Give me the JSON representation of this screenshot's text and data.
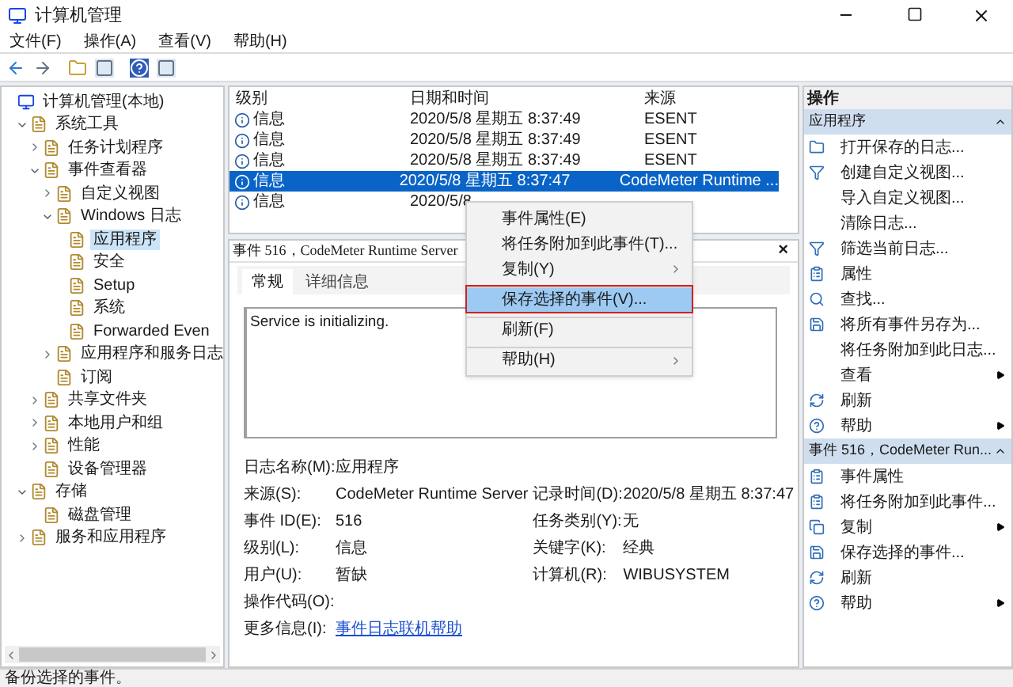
{
  "window": {
    "title": "计算机管理"
  },
  "menu": [
    "文件(F)",
    "操作(A)",
    "查看(V)",
    "帮助(H)"
  ],
  "tree": [
    {
      "label": "计算机管理(本地)",
      "selected": false,
      "children": [
        {
          "label": "系统工具",
          "expanded": true,
          "selected": false,
          "children": [
            {
              "label": "任务计划程序",
              "expanded": false,
              "selected": false
            },
            {
              "label": "事件查看器",
              "expanded": true,
              "selected": false,
              "children": [
                {
                  "label": "自定义视图",
                  "expanded": false,
                  "selected": false
                },
                {
                  "label": "Windows 日志",
                  "expanded": true,
                  "selected": false,
                  "children": [
                    {
                      "label": "应用程序",
                      "selected": true
                    },
                    {
                      "label": "安全",
                      "selected": false
                    },
                    {
                      "label": "Setup",
                      "selected": false
                    },
                    {
                      "label": "系统",
                      "selected": false
                    },
                    {
                      "label": "Forwarded Even",
                      "selected": false
                    }
                  ]
                },
                {
                  "label": "应用程序和服务日志",
                  "expanded": false,
                  "selected": false
                },
                {
                  "label": "订阅",
                  "selected": false
                }
              ]
            },
            {
              "label": "共享文件夹",
              "expanded": false,
              "selected": false
            },
            {
              "label": "本地用户和组",
              "expanded": false,
              "selected": false
            },
            {
              "label": "性能",
              "expanded": false,
              "selected": false
            },
            {
              "label": "设备管理器",
              "selected": false
            }
          ]
        },
        {
          "label": "存储",
          "expanded": true,
          "selected": false,
          "children": [
            {
              "label": "磁盘管理",
              "selected": false
            }
          ]
        },
        {
          "label": "服务和应用程序",
          "expanded": false,
          "selected": false
        }
      ]
    }
  ],
  "events": {
    "columns": [
      "级别",
      "日期和时间",
      "来源"
    ],
    "rows": [
      {
        "cells": [
          "信息",
          "2020/5/8 星期五 8:37:49",
          "ESENT"
        ],
        "selected": false
      },
      {
        "cells": [
          "信息",
          "2020/5/8 星期五 8:37:49",
          "ESENT"
        ],
        "selected": false
      },
      {
        "cells": [
          "信息",
          "2020/5/8 星期五 8:37:49",
          "ESENT"
        ],
        "selected": false
      },
      {
        "cells": [
          "信息",
          "2020/5/8 星期五 8:37:47",
          "CodeMeter Runtime ..."
        ],
        "selected": true
      },
      {
        "cells": [
          "信息",
          "2020/5/8"
        ],
        "selected": false
      }
    ]
  },
  "context_menu": [
    {
      "label": "事件属性(E)",
      "submenu": false,
      "separator_before": false,
      "selected": false
    },
    {
      "label": "将任务附加到此事件(T)...",
      "submenu": false,
      "separator_before": false,
      "selected": false
    },
    {
      "label": "复制(Y)",
      "submenu": true,
      "separator_before": false,
      "selected": false
    },
    {
      "label": "保存选择的事件(V)...",
      "submenu": false,
      "separator_before": true,
      "selected": true
    },
    {
      "label": "刷新(F)",
      "submenu": false,
      "separator_before": true,
      "selected": false
    },
    {
      "label": "帮助(H)",
      "submenu": true,
      "separator_before": true,
      "selected": false
    }
  ],
  "detail": {
    "title": "事件 516，CodeMeter Runtime Server",
    "close": "×",
    "tabs": [
      {
        "label": "常规",
        "selected": true
      },
      {
        "label": "详细信息",
        "selected": false
      }
    ],
    "message": "Service is initializing.",
    "fields_left": [
      {
        "label": "日志名称(M):",
        "value": "应用程序"
      },
      {
        "label": "来源(S):",
        "value": "CodeMeter Runtime Server"
      },
      {
        "label": "事件 ID(E):",
        "value": "516"
      },
      {
        "label": "级别(L):",
        "value": "信息"
      },
      {
        "label": "用户(U):",
        "value": "暂缺"
      },
      {
        "label": "操作代码(O):"
      },
      {
        "label": "更多信息(I):",
        "link": "事件日志联机帮助"
      }
    ],
    "fields_right": [
      {
        "label": "记录时间(D):",
        "value": "2020/5/8 星期五 8:37:47"
      },
      {
        "label": "任务类别(Y):",
        "value": "无"
      },
      {
        "label": "关键字(K):",
        "value": "经典"
      },
      {
        "label": "计算机(R):",
        "value": "WIBUSYSTEM"
      }
    ]
  },
  "actions": {
    "title": "操作",
    "sections": [
      {
        "title": "应用程序",
        "expanded": true,
        "items": [
          {
            "label": "打开保存的日志...",
            "submenu": false
          },
          {
            "label": "创建自定义视图...",
            "submenu": false
          },
          {
            "label": "导入自定义视图...",
            "submenu": false
          },
          {
            "label": "清除日志...",
            "submenu": false
          },
          {
            "label": "筛选当前日志...",
            "submenu": false
          },
          {
            "label": "属性",
            "submenu": false
          },
          {
            "label": "查找...",
            "submenu": false
          },
          {
            "label": "将所有事件另存为...",
            "submenu": false
          },
          {
            "label": "将任务附加到此日志...",
            "submenu": false
          },
          {
            "label": "查看",
            "submenu": true
          },
          {
            "label": "刷新",
            "submenu": false
          },
          {
            "label": "帮助",
            "submenu": true
          }
        ]
      },
      {
        "title": "事件 516，CodeMeter Run...",
        "expanded": true,
        "items": [
          {
            "label": "事件属性",
            "submenu": false
          },
          {
            "label": "将任务附加到此事件...",
            "submenu": false
          },
          {
            "label": "复制",
            "submenu": true
          },
          {
            "label": "保存选择的事件...",
            "submenu": false
          },
          {
            "label": "刷新",
            "submenu": false
          },
          {
            "label": "帮助",
            "submenu": true
          }
        ]
      }
    ]
  },
  "status_bar": "备份选择的事件。"
}
